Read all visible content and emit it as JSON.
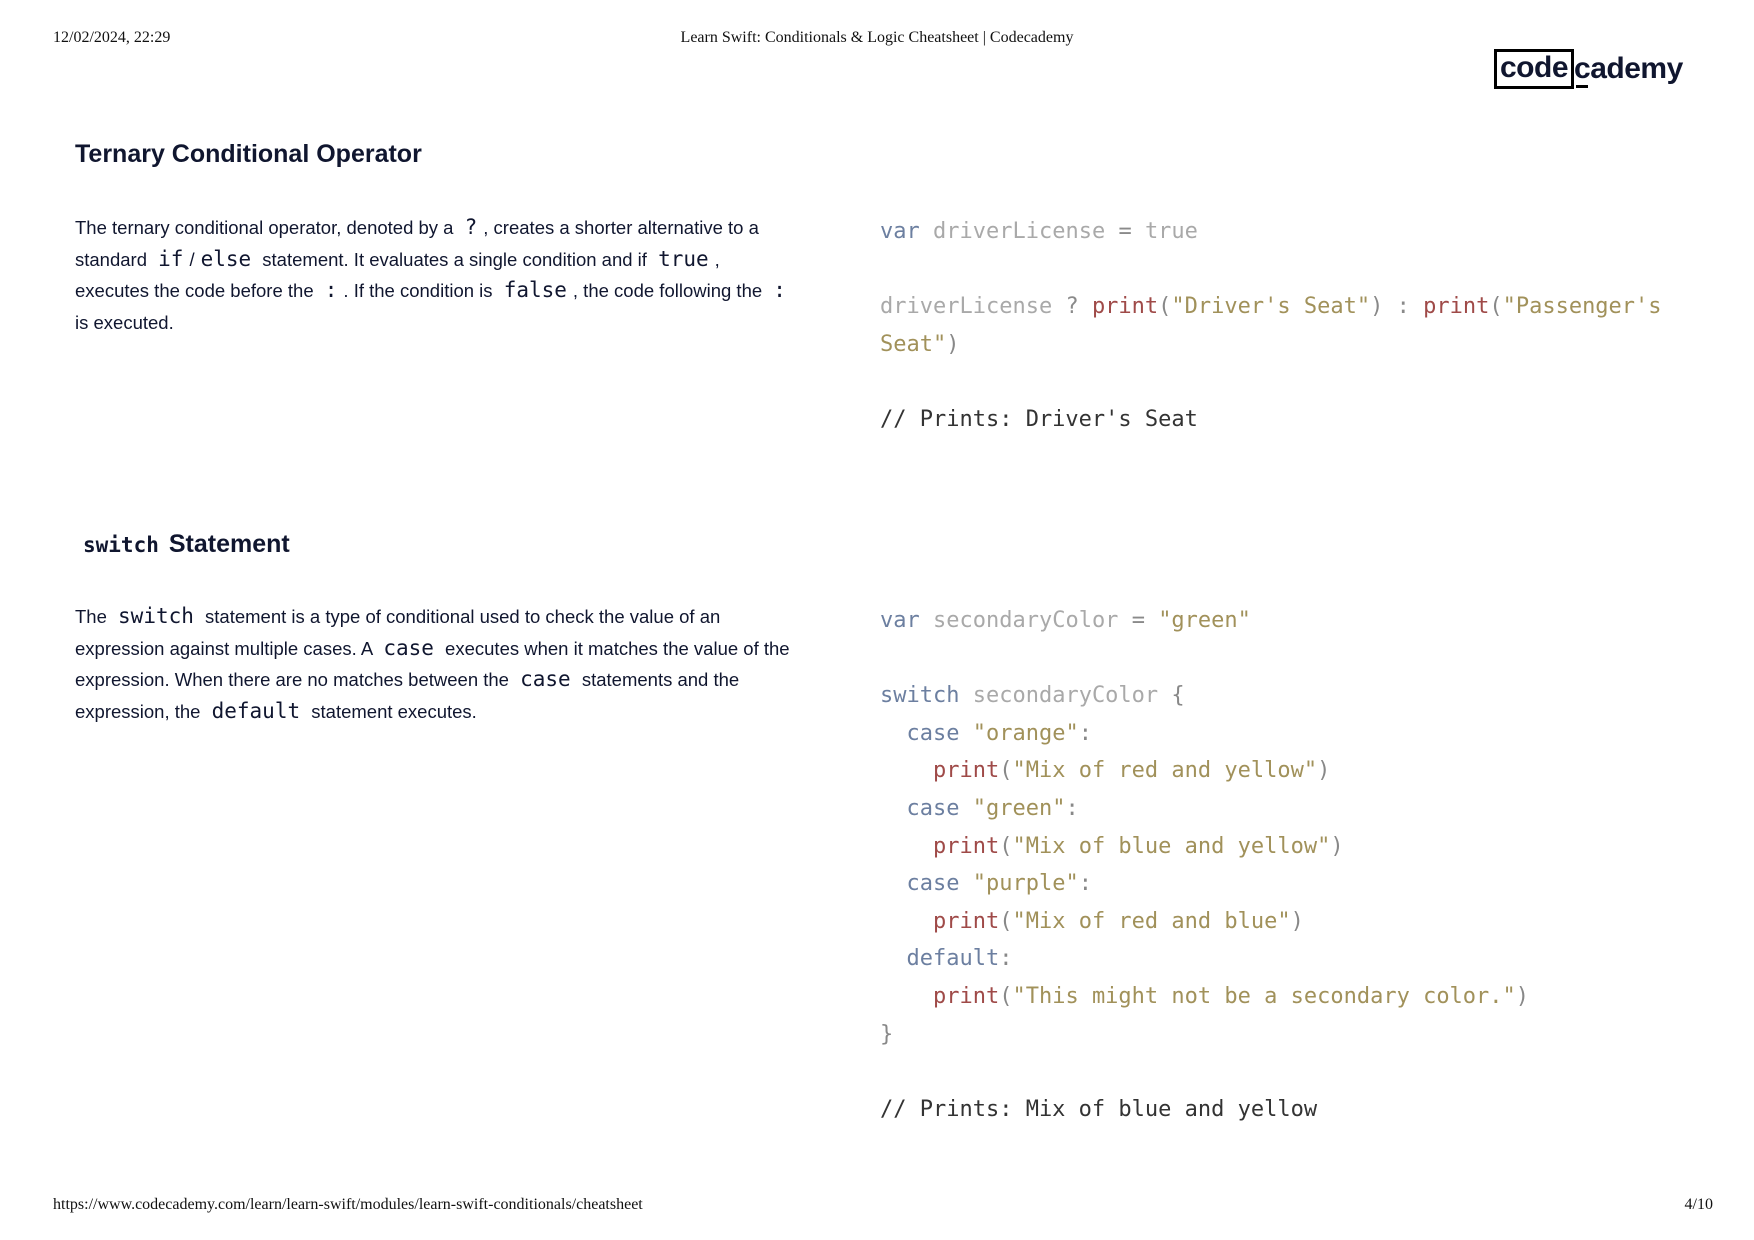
{
  "print_header": {
    "datetime": "12/02/2024, 22:29",
    "title": "Learn Swift: Conditionals & Logic Cheatsheet | Codecademy"
  },
  "logo": {
    "boxed": "code",
    "rest": "cademy"
  },
  "sections": [
    {
      "title": "Ternary Conditional Operator",
      "desc": {
        "t1": "The ternary conditional operator, denoted by a ",
        "c1": "?",
        "t2": ", creates a shorter alternative to a standard ",
        "c2": "if",
        "t3": "/",
        "c3": "else",
        "t4": " statement. It evaluates a single condition and if ",
        "c4": "true",
        "t5": ", executes the code before the ",
        "c5": ":",
        "t6": ". If the condition is ",
        "c6": "false",
        "t7": ", the code following the ",
        "c7": ":",
        "t8": " is executed."
      },
      "code": {
        "l1": {
          "kw": "var",
          "id": "driverLicense",
          "op": "=",
          "val": "true"
        },
        "l3": {
          "id": "driverLicense",
          "q": "?",
          "fn1": "print",
          "s1": "\"Driver's Seat\"",
          "colon": ":",
          "fn2": "print",
          "s2a": "\"Passenger's"
        },
        "l4": {
          "s2b": "Seat\""
        },
        "comment": "// Prints: Driver's Seat"
      }
    },
    {
      "title_code": "switch",
      "title": "Statement",
      "desc": {
        "t1": "The ",
        "c1": "switch",
        "t2": " statement is a type of conditional used to check the value of an expression against multiple cases. A ",
        "c2": "case",
        "t3": " executes when it matches the value of the expression. When there are no matches between the ",
        "c3": "case",
        "t4": " statements and the expression, the ",
        "c4": "default",
        "t5": " statement executes."
      },
      "code": {
        "decl": {
          "kw": "var",
          "id": "secondaryColor",
          "op": "=",
          "str": "\"green\""
        },
        "switch_kw": "switch",
        "switch_id": "secondaryColor",
        "open_brace": "{",
        "cases": [
          {
            "kw": "case",
            "str": "\"orange\"",
            "fn": "print",
            "msg": "\"Mix of red and yellow\""
          },
          {
            "kw": "case",
            "str": "\"green\"",
            "fn": "print",
            "msg": "\"Mix of blue and yellow\""
          },
          {
            "kw": "case",
            "str": "\"purple\"",
            "fn": "print",
            "msg": "\"Mix of red and blue\""
          }
        ],
        "default": {
          "kw": "default",
          "fn": "print",
          "msg": "\"This might not be a secondary color.\""
        },
        "close_brace": "}",
        "comment": "// Prints: Mix of blue and yellow"
      }
    }
  ],
  "print_footer": {
    "url": "https://www.codecademy.com/learn/learn-swift/modules/learn-swift-conditionals/cheatsheet",
    "page": "4/10"
  }
}
